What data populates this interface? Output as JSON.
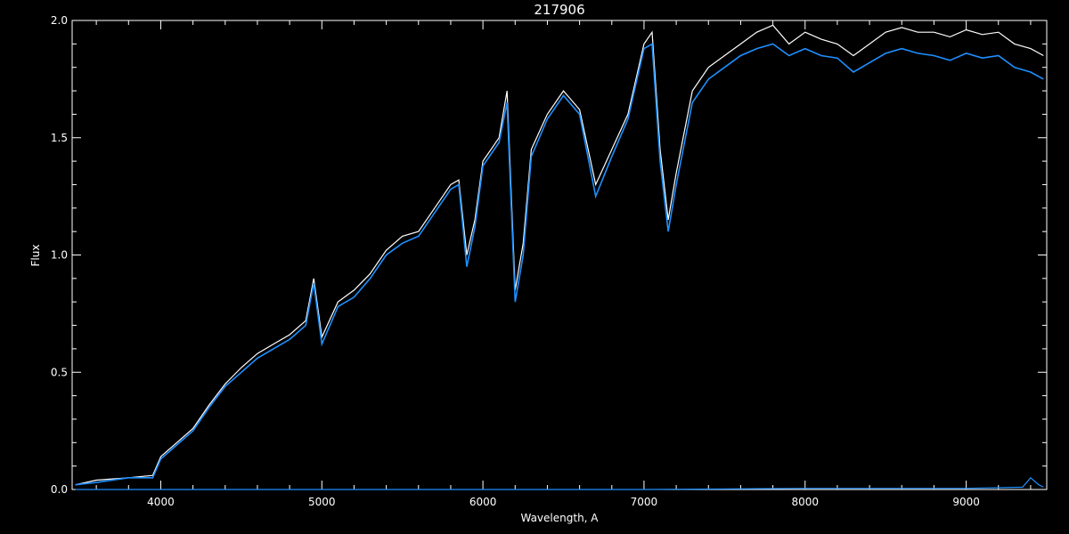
{
  "chart_data": {
    "type": "line",
    "title": "217906",
    "xlabel": "Wavelength, A",
    "ylabel": "Flux",
    "xlim": [
      3450,
      9500
    ],
    "ylim": [
      0,
      2.0
    ],
    "x_ticks": [
      4000,
      5000,
      6000,
      7000,
      8000,
      9000
    ],
    "x_tick_labels": [
      "4000",
      "5000",
      "6000",
      "7000",
      "8000",
      "9000"
    ],
    "y_ticks": [
      0.0,
      0.5,
      1.0,
      1.5,
      2.0
    ],
    "y_tick_labels": [
      "0.0",
      "0.5",
      "1.0",
      "1.5",
      "2.0"
    ],
    "grid": false,
    "background": "#000000",
    "axis_color": "#ffffff",
    "series": [
      {
        "color": "#ffffff",
        "x": [
          3470,
          3600,
          3800,
          3950,
          4000,
          4100,
          4200,
          4300,
          4400,
          4500,
          4600,
          4700,
          4800,
          4900,
          4950,
          5000,
          5100,
          5200,
          5300,
          5400,
          5500,
          5600,
          5700,
          5800,
          5850,
          5900,
          5950,
          6000,
          6100,
          6150,
          6200,
          6250,
          6300,
          6400,
          6500,
          6600,
          6700,
          6800,
          6900,
          7000,
          7050,
          7100,
          7150,
          7200,
          7300,
          7400,
          7500,
          7600,
          7700,
          7800,
          7900,
          8000,
          8100,
          8200,
          8300,
          8400,
          8500,
          8600,
          8700,
          8800,
          8900,
          9000,
          9100,
          9200,
          9300,
          9400,
          9480
        ],
        "y": [
          0.02,
          0.04,
          0.05,
          0.06,
          0.14,
          0.2,
          0.26,
          0.36,
          0.45,
          0.52,
          0.58,
          0.62,
          0.66,
          0.72,
          0.9,
          0.65,
          0.8,
          0.85,
          0.92,
          1.02,
          1.08,
          1.1,
          1.2,
          1.3,
          1.32,
          1.0,
          1.15,
          1.4,
          1.5,
          1.7,
          0.85,
          1.05,
          1.45,
          1.6,
          1.7,
          1.62,
          1.3,
          1.45,
          1.6,
          1.9,
          1.95,
          1.45,
          1.15,
          1.35,
          1.7,
          1.8,
          1.85,
          1.9,
          1.95,
          1.98,
          1.9,
          1.95,
          1.92,
          1.9,
          1.85,
          1.9,
          1.95,
          1.97,
          1.95,
          1.95,
          1.93,
          1.96,
          1.94,
          1.95,
          1.9,
          1.88,
          1.85
        ]
      },
      {
        "color": "#1e90ff",
        "x": [
          3470,
          3600,
          3800,
          3950,
          4000,
          4100,
          4200,
          4300,
          4400,
          4500,
          4600,
          4700,
          4800,
          4900,
          4950,
          5000,
          5100,
          5200,
          5300,
          5400,
          5500,
          5600,
          5700,
          5800,
          5850,
          5900,
          5950,
          6000,
          6100,
          6150,
          6200,
          6250,
          6300,
          6400,
          6500,
          6600,
          6700,
          6800,
          6900,
          7000,
          7050,
          7100,
          7150,
          7200,
          7300,
          7400,
          7500,
          7600,
          7700,
          7800,
          7900,
          8000,
          8100,
          8200,
          8300,
          8400,
          8500,
          8600,
          8700,
          8800,
          8900,
          9000,
          9100,
          9200,
          9300,
          9400,
          9480
        ],
        "y": [
          0.02,
          0.03,
          0.05,
          0.05,
          0.13,
          0.19,
          0.25,
          0.35,
          0.44,
          0.5,
          0.56,
          0.6,
          0.64,
          0.7,
          0.88,
          0.62,
          0.78,
          0.82,
          0.9,
          1.0,
          1.05,
          1.08,
          1.18,
          1.28,
          1.3,
          0.95,
          1.12,
          1.38,
          1.48,
          1.65,
          0.8,
          1.0,
          1.42,
          1.58,
          1.68,
          1.6,
          1.25,
          1.42,
          1.58,
          1.88,
          1.9,
          1.4,
          1.1,
          1.3,
          1.65,
          1.75,
          1.8,
          1.85,
          1.88,
          1.9,
          1.85,
          1.88,
          1.85,
          1.84,
          1.78,
          1.82,
          1.86,
          1.88,
          1.86,
          1.85,
          1.83,
          1.86,
          1.84,
          1.85,
          1.8,
          1.78,
          1.75
        ]
      },
      {
        "color": "#1e90ff",
        "x": [
          3470,
          7000,
          8000,
          9000,
          9350,
          9400,
          9450,
          9480
        ],
        "y": [
          0.0,
          0.0,
          0.005,
          0.005,
          0.01,
          0.05,
          0.02,
          0.01
        ]
      }
    ]
  }
}
